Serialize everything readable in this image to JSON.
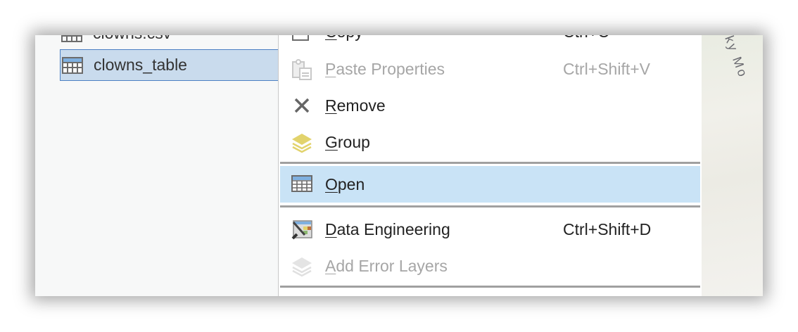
{
  "tree": {
    "items": [
      {
        "label": "clowns.csv",
        "icon": "table-icon",
        "selected": false
      },
      {
        "label": "clowns_table",
        "icon": "table-icon",
        "selected": true
      }
    ]
  },
  "menu": {
    "items": [
      {
        "label": "Copy",
        "mnemonic": "C",
        "shortcut": "Ctrl+C",
        "icon": "copy-icon",
        "enabled": true
      },
      {
        "label": "Paste Properties",
        "mnemonic": "P",
        "shortcut": "Ctrl+Shift+V",
        "icon": "paste-icon",
        "enabled": false
      },
      {
        "label": "Remove",
        "mnemonic": "R",
        "shortcut": "",
        "icon": "remove-icon",
        "enabled": true
      },
      {
        "label": "Group",
        "mnemonic": "G",
        "shortcut": "",
        "icon": "group-layers-icon",
        "enabled": true
      },
      {
        "label": "Open",
        "mnemonic": "O",
        "shortcut": "",
        "icon": "table-icon",
        "enabled": true,
        "highlighted": true
      },
      {
        "label": "Data Engineering",
        "mnemonic": "D",
        "shortcut": "Ctrl+Shift+D",
        "icon": "data-engineering-icon",
        "enabled": true
      },
      {
        "label": "Add Error Layers",
        "mnemonic": "A",
        "shortcut": "",
        "icon": "layers-icon",
        "enabled": false
      }
    ]
  },
  "map": {
    "label": "ky Mo"
  },
  "colors": {
    "selection": "#c9dbed",
    "highlight": "#c9e3f6",
    "group_icon": "#e2d36c"
  }
}
